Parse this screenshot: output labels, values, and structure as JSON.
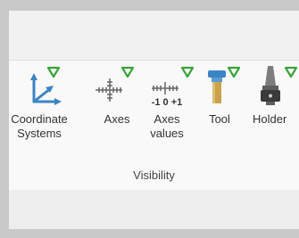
{
  "ribbon": {
    "group_label": "Visibility",
    "buttons": [
      {
        "line1": "Coordinate",
        "line2": "Systems",
        "icon": "coordinate-systems-icon"
      },
      {
        "line1": "Axes",
        "line2": "",
        "icon": "axes-icon"
      },
      {
        "line1": "Axes",
        "line2": "values",
        "icon": "axes-values-icon",
        "icon_text": "-1 0 +1"
      },
      {
        "line1": "Tool",
        "line2": "",
        "icon": "tool-icon"
      },
      {
        "line1": "Holder",
        "line2": "",
        "icon": "holder-icon"
      }
    ],
    "visibility_marker": "visible-triangle",
    "colors": {
      "accent_blue": "#3b84c4",
      "triangle_green": "#3aa33a",
      "tool_gold": "#c9a24a",
      "holder_gray": "#7d7d7d"
    }
  }
}
